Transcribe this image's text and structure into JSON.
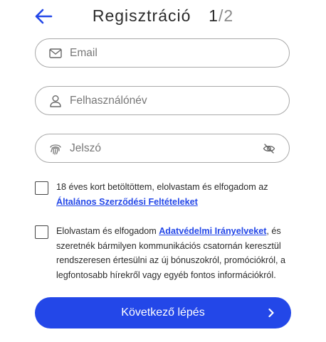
{
  "header": {
    "back_icon": "arrow-left-icon",
    "title": "Regisztráció",
    "step_current": "1",
    "step_separator": "/",
    "step_total": "2"
  },
  "form": {
    "email": {
      "placeholder": "Email",
      "value": "",
      "icon": "envelope-icon"
    },
    "username": {
      "placeholder": "Felhasználónév",
      "value": "",
      "icon": "user-icon"
    },
    "password": {
      "placeholder": "Jelszó",
      "value": "",
      "icon": "fingerprint-icon",
      "toggle_icon": "eye-off-icon"
    }
  },
  "terms": {
    "checked": false,
    "text": "18 éves kort betöltöttem, elolvastam és elfogadom az",
    "link": "Általános Szerződési Feltételeket"
  },
  "privacy": {
    "checked": false,
    "text_before": "Elolvastam és elfogadom",
    "link": "Adatvédelmi Irányelveket",
    "text_after": ", és szeretnék bármilyen kommunikációs csatornán keresztül rendszeresen értesülni az új bónuszokról, promóciókról, a legfontosabb hírekről vagy egyéb fontos információkról."
  },
  "next_button": {
    "label": "Következő lépés",
    "icon": "chevron-right-icon"
  },
  "colors": {
    "accent": "#2347e8",
    "border": "#a9a9a9",
    "text": "#2b2b2b"
  }
}
